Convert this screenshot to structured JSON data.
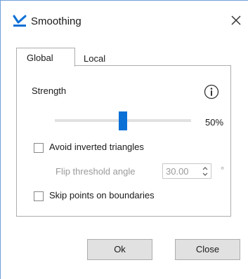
{
  "window": {
    "title": "Smoothing"
  },
  "tabs": [
    {
      "label": "Global",
      "active": true
    },
    {
      "label": "Local",
      "active": false
    }
  ],
  "strength": {
    "label": "Strength",
    "value_text": "50%",
    "value": 50
  },
  "options": {
    "avoid_inverted": {
      "label": "Avoid inverted triangles",
      "checked": false
    },
    "flip_threshold": {
      "label": "Flip threshold angle",
      "value": "30.00",
      "unit": "°",
      "enabled": false
    },
    "skip_boundaries": {
      "label": "Skip points on boundaries",
      "checked": false
    }
  },
  "buttons": {
    "ok": "Ok",
    "close": "Close"
  },
  "icons": {
    "app": "mesh-tool-icon",
    "info": "info-icon",
    "close": "close-icon"
  },
  "colors": {
    "accent": "#0a70d6",
    "disabled_text": "#9a9a9a",
    "window_edge": "#6f9fd8"
  }
}
